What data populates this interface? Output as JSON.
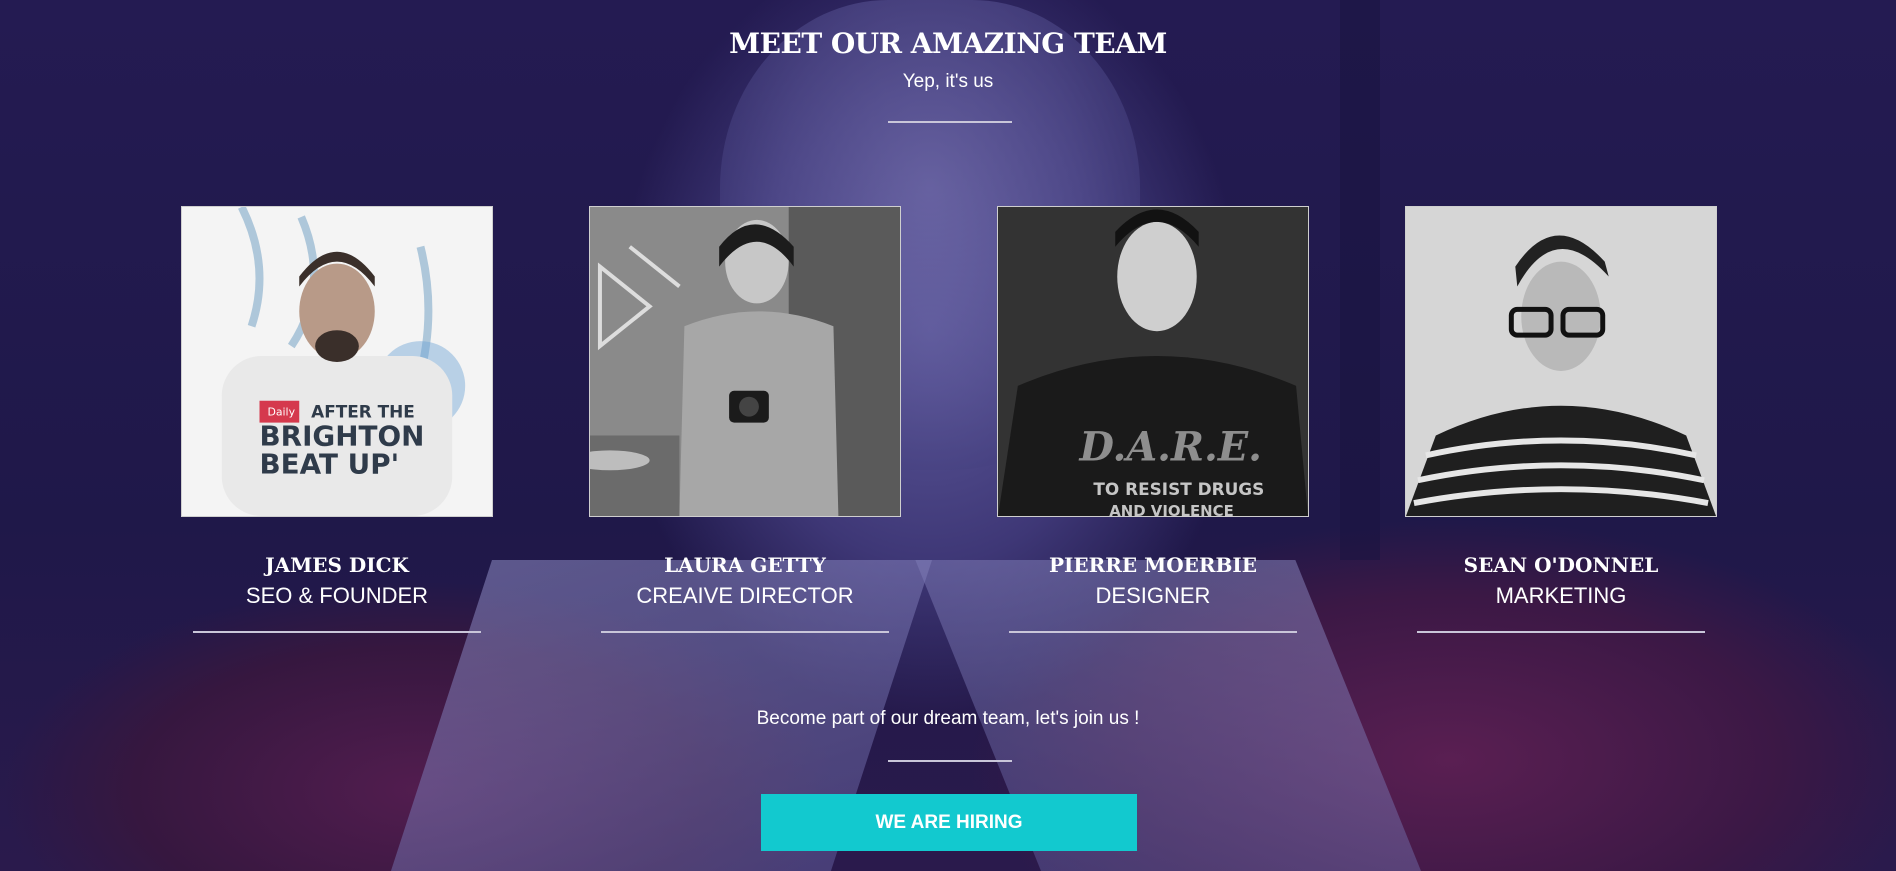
{
  "header": {
    "title": "MEET OUR AMAZING TEAM",
    "subtitle": "Yep, it's us"
  },
  "team": [
    {
      "name": "JAMES DICK",
      "role": "SEO & FOUNDER",
      "photo": "portrait-photo"
    },
    {
      "name": "LAURA GETTY",
      "role": "CREAIVE DIRECTOR",
      "photo": "portrait-photo"
    },
    {
      "name": "PIERRE MOERBIE",
      "role": "DESIGNER",
      "photo": "portrait-photo"
    },
    {
      "name": "SEAN O'DONNEL",
      "role": "MARKETING",
      "photo": "portrait-photo"
    }
  ],
  "photo_text": {
    "shirt_1_line_1": "Daily",
    "shirt_1_line_2": "AFTER THE",
    "shirt_1_line_3": "BRIGHTON",
    "shirt_1_line_4": "BEAT UP'",
    "shirt_3_line_1": "D.A.R.E.",
    "shirt_3_line_2": "TO RESIST DRUGS",
    "shirt_3_line_3": "AND VIOLENCE"
  },
  "join": {
    "text": "Become part of our dream team, let's join us !",
    "button_label": "WE ARE HIRING"
  },
  "colors": {
    "background": "#221a4e",
    "accent": "#12c9cf",
    "divider": "#c9c6d9"
  }
}
